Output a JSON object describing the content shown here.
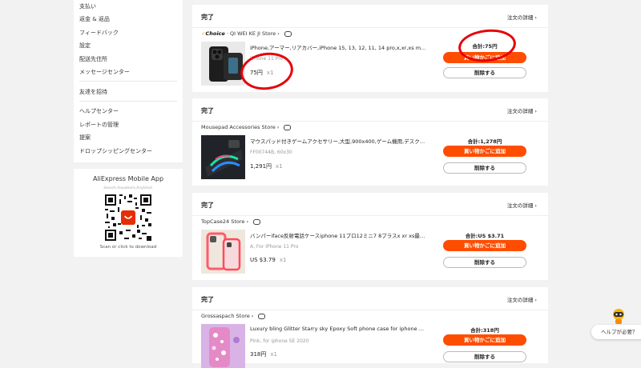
{
  "sidebar": {
    "items": [
      {
        "label": "支払い"
      },
      {
        "label": "返金 & 返品"
      },
      {
        "label": "フィードバック"
      },
      {
        "label": "設定"
      },
      {
        "label": "配送先住所"
      },
      {
        "label": "メッセージセンター"
      },
      {
        "label": "友達を招待"
      },
      {
        "label": "ヘルプセンター"
      },
      {
        "label": "レポートの管理"
      },
      {
        "label": "提案"
      },
      {
        "label": "ドロップシッピングセンター"
      }
    ]
  },
  "app_promo": {
    "title": "AliExpress Mobile App",
    "subtitle": "Search Anywhere,Anytime!",
    "scan_text": "Scan or click to download"
  },
  "orders": [
    {
      "status": "完了",
      "detail_link": "注文の詳細",
      "store_badge_main": "Choice",
      "store_name": "QI WEI KE JI Store",
      "title": "iPhone,アーマー,リアカバー,iPhone 15, 13, 12, 11, 14 pro,x,xr,xs max,12...",
      "variant": "iPhone 11 Pro",
      "price": "75円",
      "qty": "x1",
      "total": "合計:75円",
      "cart_button": "買い物かごに追加",
      "delete_button": "削除する"
    },
    {
      "status": "完了",
      "detail_link": "注文の詳細",
      "store_name": "Mousepad Accessories Store",
      "title": "マウスパッド付きゲームアクセサリー,大型,900x400,ゲーム機用,デスクト...",
      "variant": "FF00744B, 60x30",
      "price": "1,291円",
      "qty": "x1",
      "total": "合計:1,278円",
      "cart_button": "買い物かごに追加",
      "delete_button": "削除する"
    },
    {
      "status": "完了",
      "detail_link": "注文の詳細",
      "store_name": "TopCase24 Store",
      "title": "バンパーiface反射電話ケースiphone 11プロ12ミニ7 8プラスx xr xs最大...",
      "variant": "A, For iPhone 11 Pro",
      "price": "US $3.79",
      "qty": "x1",
      "total": "合計:US $3.71",
      "cart_button": "買い物かごに追加",
      "delete_button": "削除する"
    },
    {
      "status": "完了",
      "detail_link": "注文の詳細",
      "store_name": "Grossaspach Store",
      "title": "Luxury bling Glitter Starry sky Epoxy Soft phone case for iphone X XR X...",
      "variant": "Pink, for iphone SE 2020",
      "price": "318円",
      "qty": "x1",
      "total": "合計:318円",
      "cart_button": "買い物かごに追加",
      "delete_button": "削除する"
    }
  ],
  "help": {
    "label": "ヘルプが必要？"
  },
  "colors": {
    "accent": "#ff4d00",
    "annotation": "#e6000a",
    "background": "#f2f2f2"
  }
}
